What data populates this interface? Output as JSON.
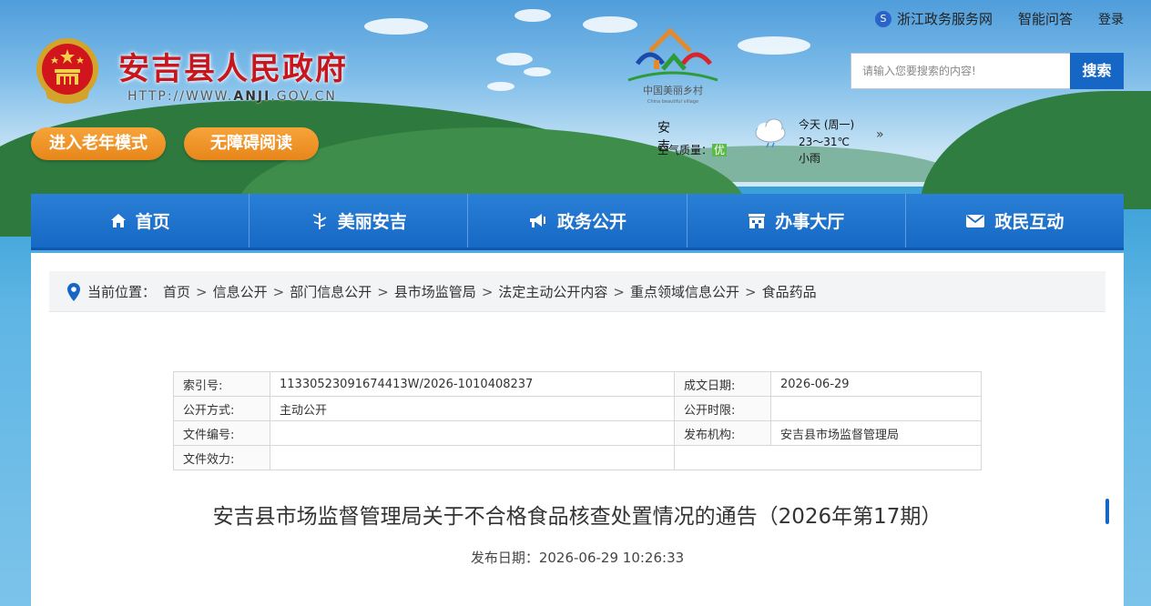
{
  "header": {
    "site_title": "安吉县人民政府",
    "site_url_prefix": "HTTP://WWW.",
    "site_url_domain": "ANJI",
    "site_url_suffix": ".GOV.CN",
    "elder_mode_button": "进入老年模式",
    "accessible_reading_button": "无障碍阅读",
    "village_logo_text": "中国美丽乡村",
    "village_logo_subtext": "China beautiful village"
  },
  "toplinks": {
    "zhejiang_service": "浙江政务服务网",
    "smart_qa": "智能问答",
    "login": "登录"
  },
  "search": {
    "placeholder": "请输入您要搜索的内容!",
    "button": "搜索"
  },
  "weather": {
    "city": "安吉",
    "air_quality_label": "空气质量：",
    "air_quality_value": "优",
    "day": "今天 (周一)",
    "temperature": "23～31℃",
    "condition": "小雨",
    "more": "»"
  },
  "nav": {
    "items": [
      {
        "label": "首页",
        "icon": "home-icon"
      },
      {
        "label": "美丽安吉",
        "icon": "bamboo-icon"
      },
      {
        "label": "政务公开",
        "icon": "megaphone-icon"
      },
      {
        "label": "办事大厅",
        "icon": "building-icon"
      },
      {
        "label": "政民互动",
        "icon": "mail-icon"
      }
    ]
  },
  "breadcrumb": {
    "label": "当前位置：",
    "items": [
      "首页",
      "信息公开",
      "部门信息公开",
      "县市场监管局",
      "法定主动公开内容",
      "重点领域信息公开",
      "食品药品"
    ],
    "separator": ">"
  },
  "meta_table": {
    "rows": [
      {
        "k1": "索引号:",
        "v1": "11330523091674413W/2026-1010408237",
        "k2": "成文日期:",
        "v2": "2026-06-29"
      },
      {
        "k1": "公开方式:",
        "v1": "主动公开",
        "k2": "公开时限:",
        "v2": ""
      },
      {
        "k1": "文件编号:",
        "v1": "",
        "k2": "发布机构:",
        "v2": "安吉县市场监督管理局"
      },
      {
        "k1": "文件效力:",
        "v1": "",
        "k2": "",
        "v2": ""
      }
    ]
  },
  "article": {
    "title": "安吉县市场监督管理局关于不合格食品核查处置情况的通告（2026年第17期）",
    "publish_date": "发布日期：2026-06-29 10:26:33"
  },
  "colors": {
    "primary_blue": "#1667c5",
    "title_red": "#c8161d",
    "pill_orange": "#e8861a"
  }
}
